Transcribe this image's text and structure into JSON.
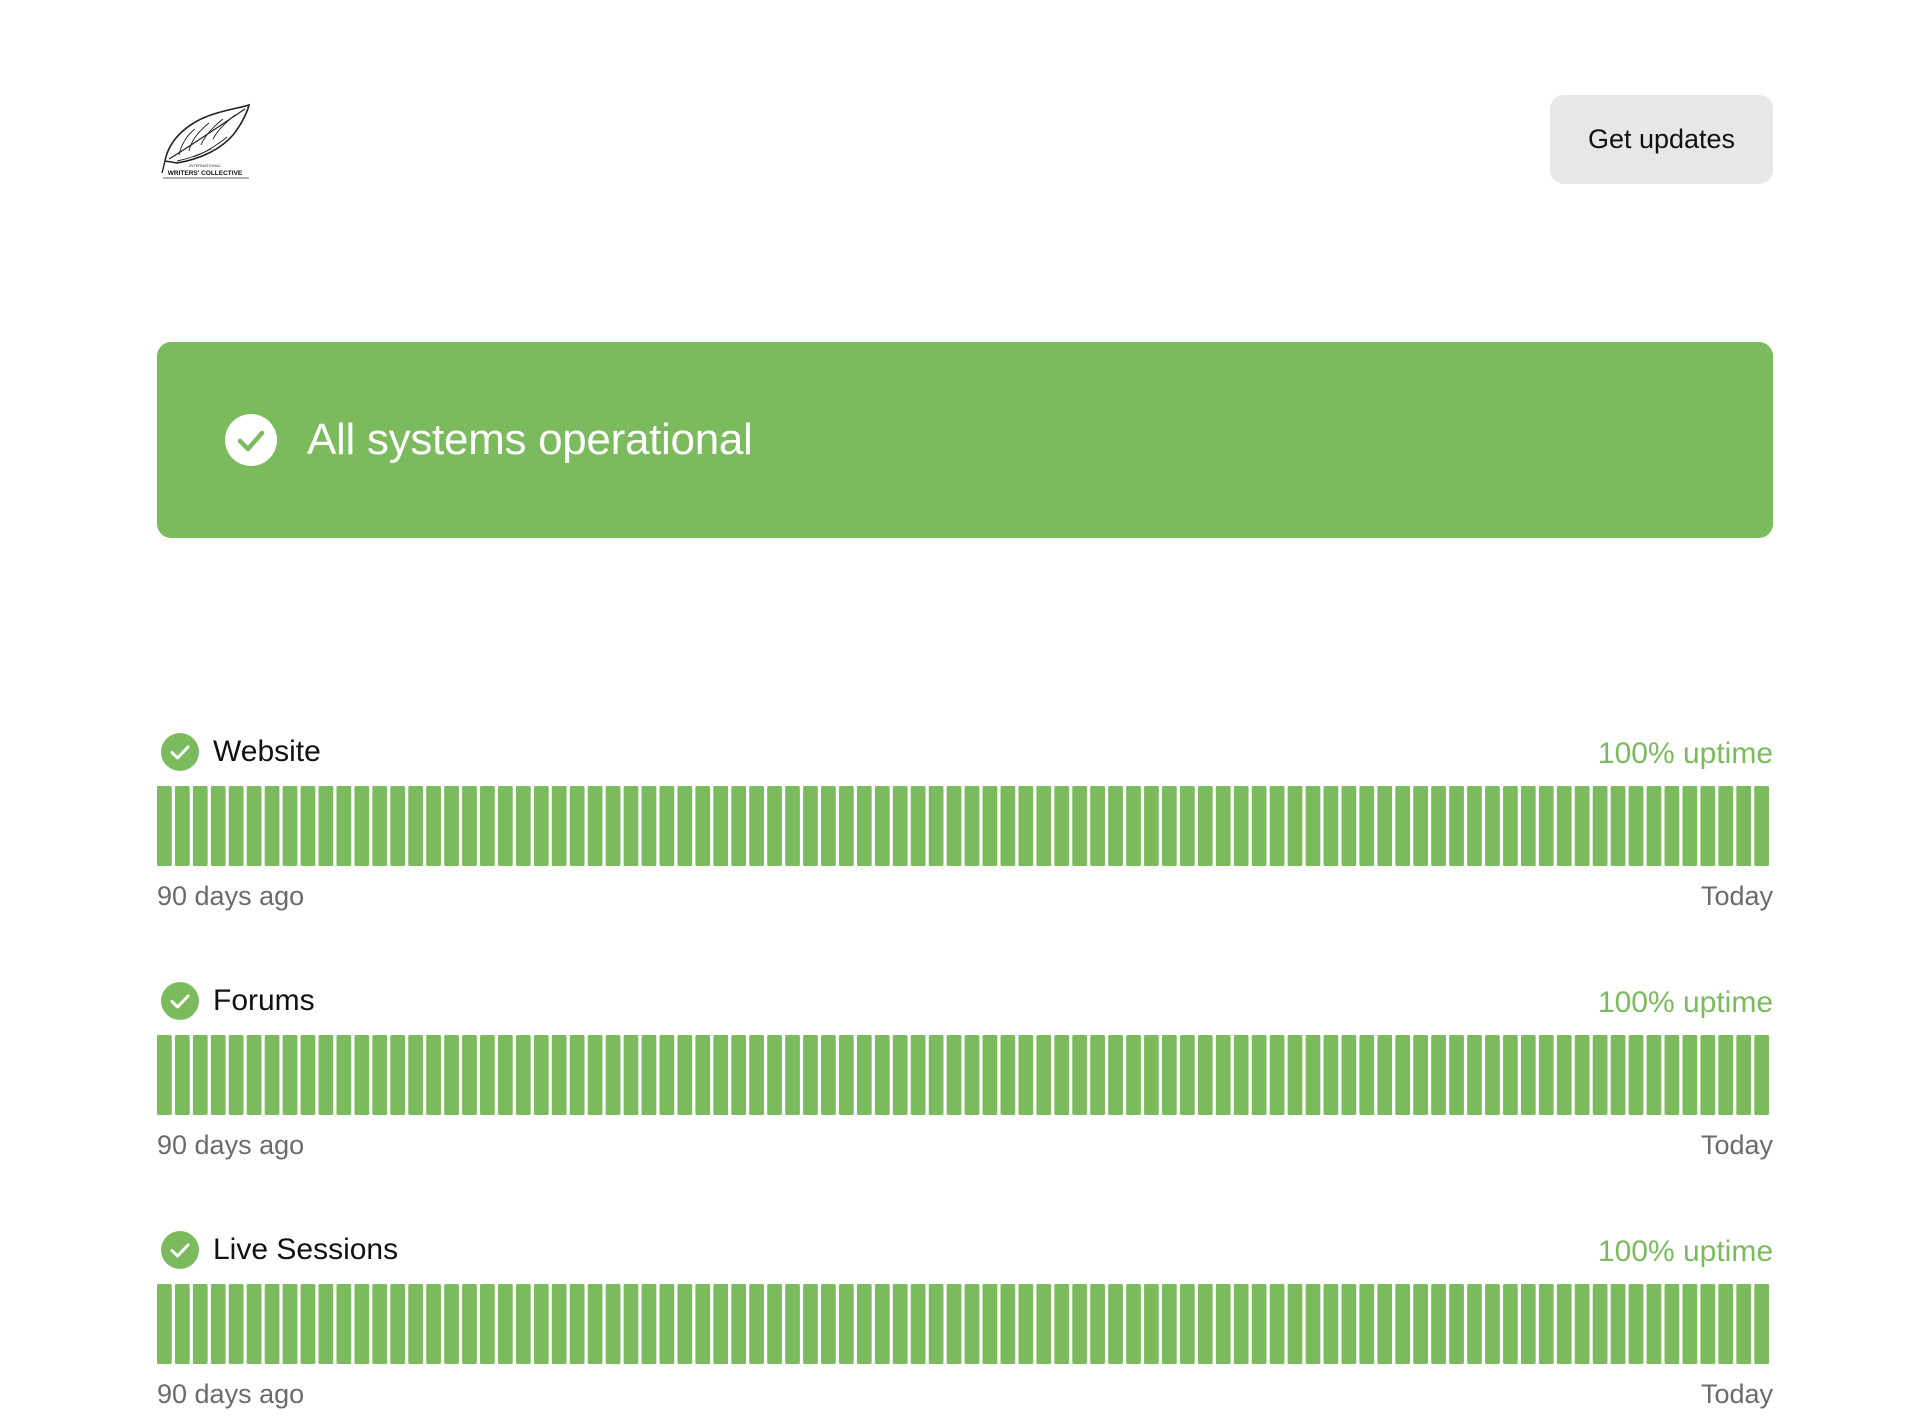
{
  "header": {
    "logo_icon": "writers-collective-logo",
    "logo_text_top": "INTERNATIONAL",
    "logo_text_bottom": "WRITERS' COLLECTIVE",
    "get_updates_label": "Get updates"
  },
  "banner": {
    "icon": "check-circle-icon",
    "text": "All systems operational",
    "color": "#7cbb5d"
  },
  "components": [
    {
      "name": "Website",
      "uptime": "100% uptime",
      "start_label": "90 days ago",
      "end_label": "Today",
      "days": 90,
      "status": "operational"
    },
    {
      "name": "Forums",
      "uptime": "100% uptime",
      "start_label": "90 days ago",
      "end_label": "Today",
      "days": 90,
      "status": "operational"
    },
    {
      "name": "Live Sessions",
      "uptime": "100% uptime",
      "start_label": "90 days ago",
      "end_label": "Today",
      "days": 90,
      "status": "operational"
    }
  ],
  "colors": {
    "operational": "#7cbb5d",
    "muted_text": "#6b6b6b",
    "button_bg": "#e7e7e7"
  }
}
